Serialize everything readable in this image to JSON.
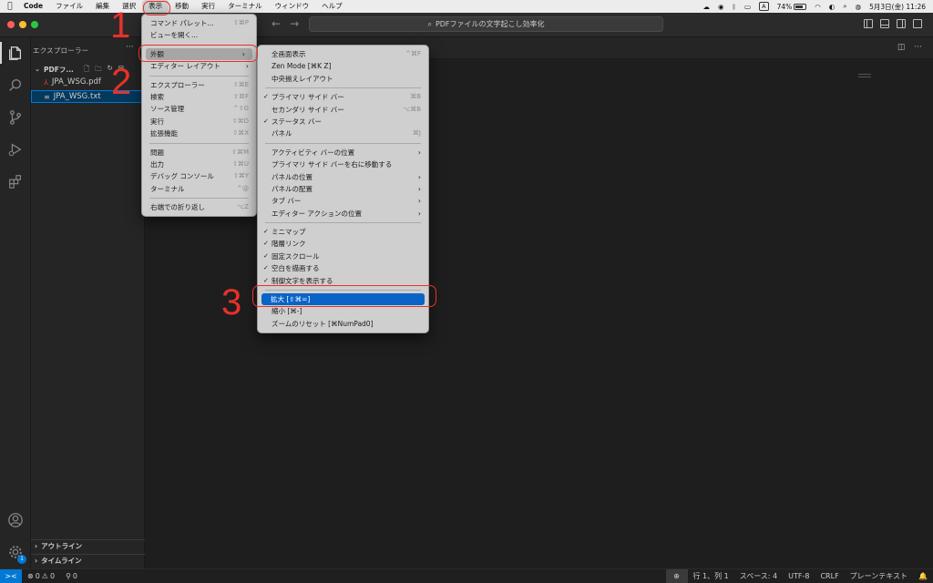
{
  "menubar": {
    "app": "Code",
    "items": [
      "ファイル",
      "編集",
      "選択",
      "表示",
      "移動",
      "実行",
      "ターミナル",
      "ウィンドウ",
      "ヘルプ"
    ],
    "active_index": 3,
    "status": {
      "input_mode": "A",
      "battery": "74%",
      "battery_fraction": 0.74,
      "datetime": "5月3日(金) 11:26"
    }
  },
  "titlebar": {
    "search_text": "PDFファイルの文字起こし効率化"
  },
  "sidebar": {
    "title": "エクスプローラー",
    "more": "···",
    "folder": "PDFフ...",
    "files": [
      {
        "name": "JPA_WSG.pdf",
        "icon": "pdf-file-icon",
        "selected": false
      },
      {
        "name": "JPA_WSG.txt",
        "icon": "text-file-icon",
        "selected": true
      }
    ],
    "sections": [
      "アウトライン",
      "タイムライン"
    ]
  },
  "activity": {
    "badge": "1"
  },
  "statusbar": {
    "remote": "><",
    "errors": "0",
    "warnings": "0",
    "ports": "0",
    "position": "行 1、列 1",
    "spaces": "スペース: 4",
    "encoding": "UTF-8",
    "eol": "CRLF",
    "language": "プレーンテキスト"
  },
  "view_menu": {
    "items": [
      {
        "label": "コマンド パレット...",
        "shortcut": "⇧⌘P"
      },
      {
        "label": "ビューを開く...",
        "shortcut": ""
      },
      {
        "sep": true
      },
      {
        "label": "外観",
        "submenu": true,
        "highlight": true
      },
      {
        "label": "エディター レイアウト",
        "submenu": true
      },
      {
        "sep": true
      },
      {
        "label": "エクスプローラー",
        "shortcut": "⇧⌘E"
      },
      {
        "label": "検索",
        "shortcut": "⇧⌘F"
      },
      {
        "label": "ソース管理",
        "shortcut": "^⇧G"
      },
      {
        "label": "実行",
        "shortcut": "⇧⌘D"
      },
      {
        "label": "拡張機能",
        "shortcut": "⇧⌘X"
      },
      {
        "sep": true
      },
      {
        "label": "問題",
        "shortcut": "⇧⌘M"
      },
      {
        "label": "出力",
        "shortcut": "⇧⌘U"
      },
      {
        "label": "デバッグ コンソール",
        "shortcut": "⇧⌘Y"
      },
      {
        "label": "ターミナル",
        "shortcut": "^@"
      },
      {
        "sep": true
      },
      {
        "label": "右端での折り返し",
        "shortcut": "⌥Z"
      }
    ]
  },
  "appearance_menu": {
    "items": [
      {
        "label": "全画面表示",
        "shortcut": "^⌘F"
      },
      {
        "label": "Zen Mode [⌘K Z]",
        "shortcut": ""
      },
      {
        "label": "中央揃えレイアウト",
        "shortcut": ""
      },
      {
        "sep": true
      },
      {
        "label": "プライマリ サイド バー",
        "shortcut": "⌘B",
        "checked": true
      },
      {
        "label": "セカンダリ サイド バー",
        "shortcut": "⌥⌘B"
      },
      {
        "label": "ステータス バー",
        "shortcut": "",
        "checked": true
      },
      {
        "label": "パネル",
        "shortcut": "⌘J"
      },
      {
        "sep": true
      },
      {
        "label": "アクティビティ バーの位置",
        "submenu": true
      },
      {
        "label": "プライマリ サイド バーを右に移動する",
        "shortcut": ""
      },
      {
        "label": "パネルの位置",
        "submenu": true
      },
      {
        "label": "パネルの配置",
        "submenu": true
      },
      {
        "label": "タブ バー",
        "submenu": true
      },
      {
        "label": "エディター アクションの位置",
        "submenu": true
      },
      {
        "sep": true
      },
      {
        "label": "ミニマップ",
        "checked": true
      },
      {
        "label": "階層リンク",
        "checked": true
      },
      {
        "label": "固定スクロール",
        "checked": true
      },
      {
        "label": "空白を描画する",
        "checked": true
      },
      {
        "label": "制御文字を表示する",
        "checked": true
      },
      {
        "sep": true
      },
      {
        "label": "拡大 [⇧⌘=]",
        "highlight_blue": true
      },
      {
        "label": "縮小 [⌘-]"
      },
      {
        "label": "ズームのリセット [⌘NumPad0]"
      }
    ]
  },
  "annotations": [
    "1",
    "2",
    "3"
  ]
}
